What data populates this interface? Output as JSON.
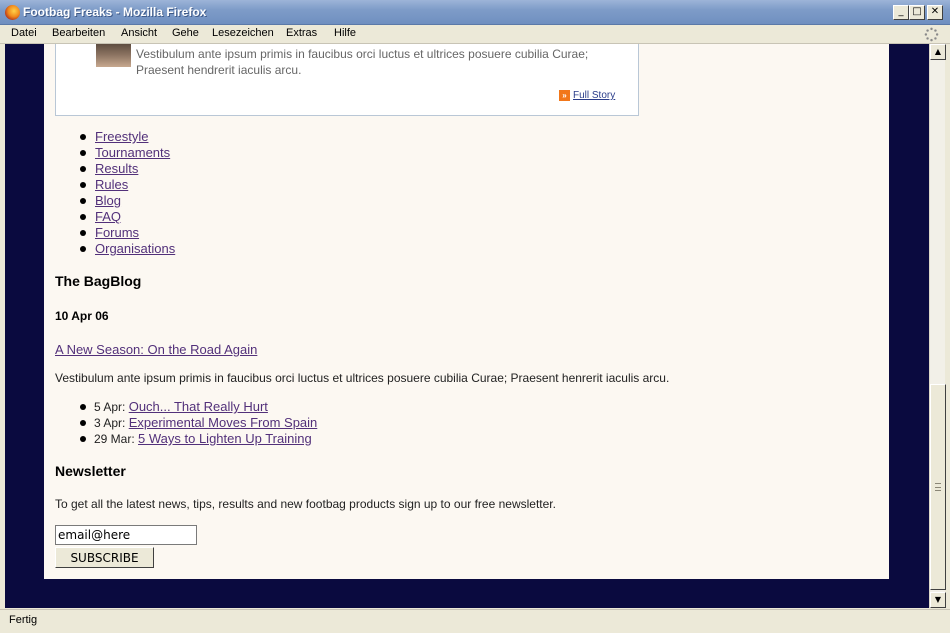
{
  "window": {
    "title": "Footbag Freaks - Mozilla Firefox"
  },
  "menu": {
    "items": [
      "Datei",
      "Bearbeiten",
      "Ansicht",
      "Gehe",
      "Lesezeichen",
      "Extras",
      "Hilfe"
    ]
  },
  "story": {
    "text": "Vestibulum ante ipsum primis in faucibus orci luctus et ultrices posuere cubilia Curae; Praesent hendrerit iaculis arcu.",
    "link": "Full Story"
  },
  "nav": {
    "items": [
      "Freestyle",
      "Tournaments",
      "Results",
      "Rules",
      "Blog",
      "FAQ",
      "Forums",
      "Organisations"
    ]
  },
  "blog": {
    "heading": "The BagBlog",
    "date": "10 Apr 06",
    "post_title": "A New Season: On the Road Again",
    "post_text": "Vestibulum ante ipsum primis in faucibus orci luctus et ultrices posuere cubilia Curae; Praesent henrerit iaculis arcu.",
    "recent": [
      {
        "date": "5 Apr:",
        "title": "Ouch... That Really Hurt"
      },
      {
        "date": "3 Apr:",
        "title": "Experimental Moves From Spain"
      },
      {
        "date": "29 Mar:",
        "title": "5 Ways to Lighten Up Training"
      }
    ]
  },
  "newsletter": {
    "heading": "Newsletter",
    "text": "To get all the latest news, tips, results and new footbag products sign up to our free newsletter.",
    "email_value": "email@here",
    "button": "SUBSCRIBE"
  },
  "status": {
    "text": "Fertig"
  },
  "colors": {
    "page_background": "#0a0a3f",
    "content_background": "#fcf8f2",
    "link": "#52307a"
  }
}
